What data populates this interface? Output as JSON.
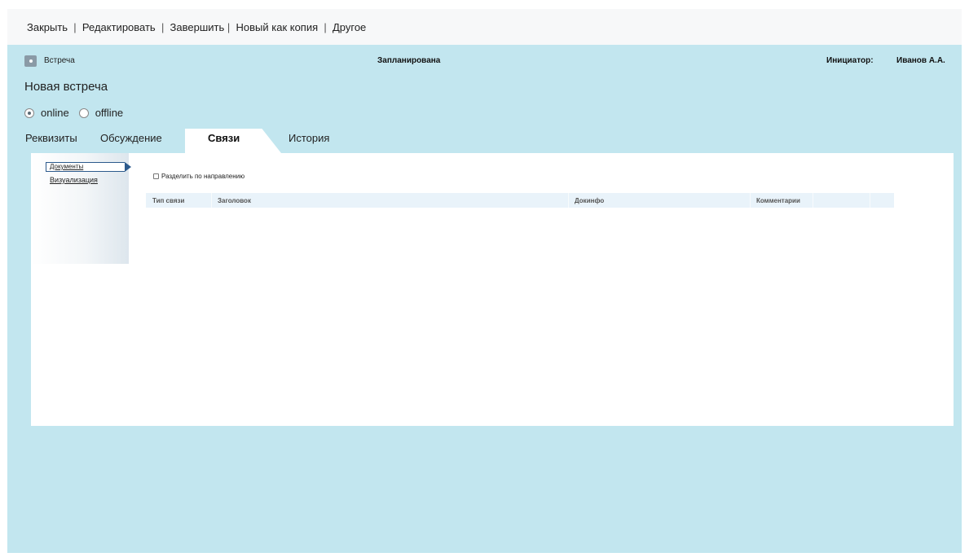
{
  "toolbar": {
    "close": "Закрыть",
    "sep1": "  |  ",
    "edit": "Редактировать",
    "sep2": "  |  ",
    "finish": "Завершить",
    "sep3": " |  ",
    "copy": "Новый как копия",
    "sep4": "  |  ",
    "other": "Другое"
  },
  "header": {
    "doc_type": "Встреча",
    "status": "Запланирована",
    "initiator_label": "Инициатор:",
    "initiator_value": "Иванов А.А.",
    "title": "Новая встреча"
  },
  "mode": {
    "options": [
      {
        "label": "online",
        "checked": true
      },
      {
        "label": "offline",
        "checked": false
      }
    ]
  },
  "tabs": [
    {
      "label": "Реквизиты"
    },
    {
      "label": "Обсуждение"
    },
    {
      "label": "Связи",
      "active": true
    },
    {
      "label": "История"
    }
  ],
  "links_panel": {
    "nav": [
      {
        "label": "Документы",
        "active": true
      },
      {
        "label": "Визуализация"
      }
    ],
    "split_checkbox": "Разделить по направлению",
    "columns": [
      "Тип связи",
      "Заголовок",
      "Докинфо",
      "Комментарии"
    ]
  },
  "colors": {
    "page_bg": "#c2e6ef",
    "panel_bg": "#ffffff",
    "grid_header_bg": "#e9f3fa",
    "active_nav_border": "#2c5a8c"
  }
}
